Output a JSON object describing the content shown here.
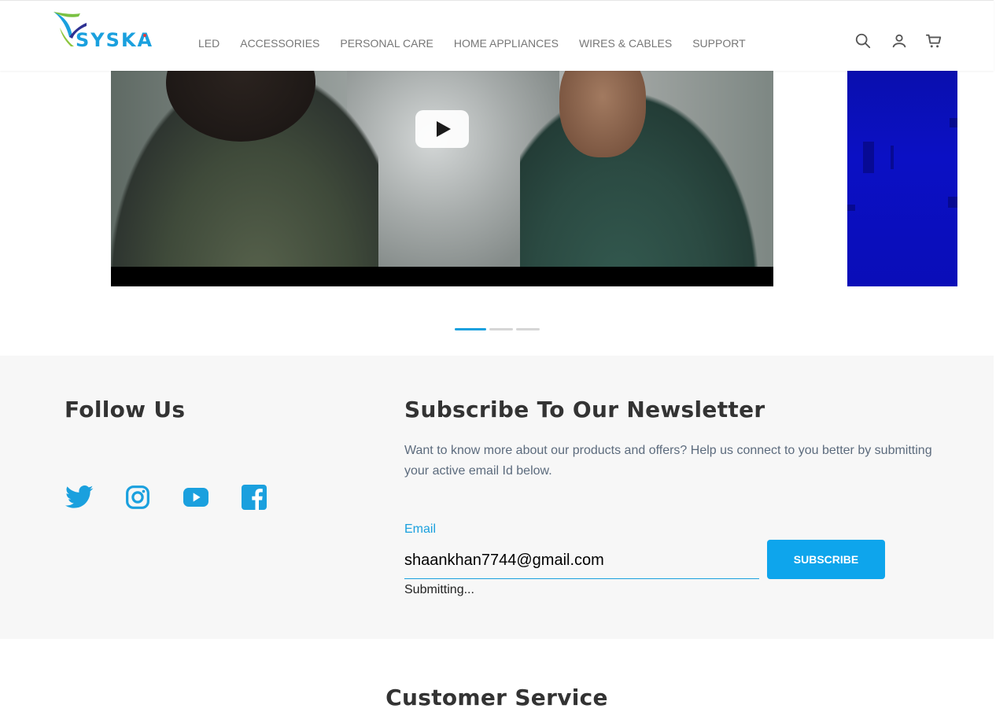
{
  "header": {
    "brand": "SYSKA",
    "nav": [
      "LED",
      "ACCESSORIES",
      "PERSONAL CARE",
      "HOME APPLIANCES",
      "WIRES & CABLES",
      "SUPPORT"
    ],
    "icons": [
      "search-icon",
      "user-icon",
      "cart-icon"
    ]
  },
  "carousel": {
    "play_icon": "play-icon",
    "active_slide": 1,
    "slide_count": 3
  },
  "follow": {
    "title": "Follow Us",
    "socials": [
      "twitter-icon",
      "instagram-icon",
      "youtube-icon",
      "facebook-icon"
    ]
  },
  "newsletter": {
    "title": "Subscribe To Our Newsletter",
    "description": "Want to know more about our products and offers? Help us connect to you better by submitting your active email Id below.",
    "email_label": "Email",
    "email_value": "shaankhan7744@gmail.com",
    "button_label": "SUBSCRIBE",
    "status": "Submitting..."
  },
  "customer_service": {
    "title": "Customer Service"
  },
  "colors": {
    "accent": "#1aa0de",
    "button": "#0ea5ec",
    "band_bg": "#f7f7f7",
    "heading": "#333333"
  }
}
